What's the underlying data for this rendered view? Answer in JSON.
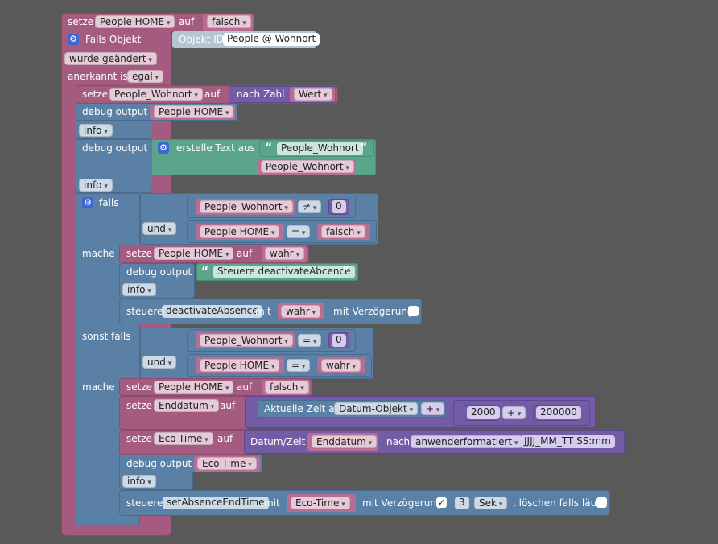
{
  "outer": {
    "setze": "setze",
    "var": "People HOME",
    "auf": "auf",
    "value": "falsch",
    "falls_objekt": "Falls Objekt",
    "objekt_id": "Objekt ID",
    "object_name": "People @ Wohnort",
    "wurde": "wurde geändert",
    "anerkannt": "anerkannt ist",
    "egal": "egal"
  },
  "block1": {
    "setze": "setze",
    "var": "People_Wohnort",
    "auf": "auf",
    "nach_zahl": "nach Zahl",
    "wert": "Wert"
  },
  "debug1": {
    "label": "debug output",
    "value": "People HOME",
    "level": "info"
  },
  "debug2": {
    "label": "debug output",
    "erstelle": "erstelle Text aus",
    "text": "People_Wohnort",
    "var": "People_Wohnort",
    "level": "info"
  },
  "if1": {
    "falls": "falls",
    "c1_var": "People_Wohnort",
    "c1_op": "≠",
    "c1_val": "0",
    "und": "und",
    "c2_var": "People HOME",
    "c2_op": "=",
    "c2_val": "falsch",
    "mache": "mache",
    "s1_setze": "setze",
    "s1_var": "People HOME",
    "s1_auf": "auf",
    "s1_val": "wahr",
    "d_label": "debug output",
    "d_text": "Steuere deactivateAbcence",
    "d_level": "info",
    "st_label": "steuere",
    "st_target": "deactivateAbsence",
    "st_mit": "mit",
    "st_val": "wahr",
    "st_delay": "mit Verzögerung",
    "sonst": "sonst falls",
    "c3_var": "People_Wohnort",
    "c3_op": "=",
    "c3_val": "0",
    "und2": "und",
    "c4_var": "People HOME",
    "c4_op": "=",
    "c4_val": "wahr",
    "mache2": "mache",
    "s2_setze": "setze",
    "s2_var": "People HOME",
    "s2_auf": "auf",
    "s2_val": "falsch",
    "s3_setze": "setze",
    "s3_var": "Enddatum",
    "s3_auf": "auf",
    "aktuelle": "Aktuelle Zeit als",
    "datum_obj": "Datum-Objekt",
    "plus": "+",
    "n1": "2000",
    "plus2": "+",
    "n2": "200000",
    "s4_setze": "setze",
    "s4_var": "Eco-Time",
    "s4_auf": "auf",
    "datumzeit": "Datum/Zeit",
    "enddatum": "Enddatum",
    "nach": "nach",
    "format": "anwenderformatiert",
    "pattern": "JJJJ_MM_TT SS:mm",
    "d2_label": "debug output",
    "d2_val": "Eco-Time",
    "d2_level": "info",
    "st2_label": "steuere",
    "st2_target": "setAbsenceEndTime",
    "st2_mit": "mit",
    "st2_val": "Eco-Time",
    "st2_delay": "mit Verzögerung",
    "st2_check": "✓",
    "st2_num": "3",
    "st2_unit": "Sek",
    "st2_clear": ", löschen falls läuft"
  },
  "colors": {
    "canvas": "#595959",
    "logic_block": "#a55b80",
    "control_block": "#5b80a5",
    "math_block": "#745ba5",
    "text_block": "#5ba58c"
  },
  "icons": {
    "settings": "gear-icon",
    "quote": "quote-icon",
    "checkbox": "checkbox-icon"
  }
}
